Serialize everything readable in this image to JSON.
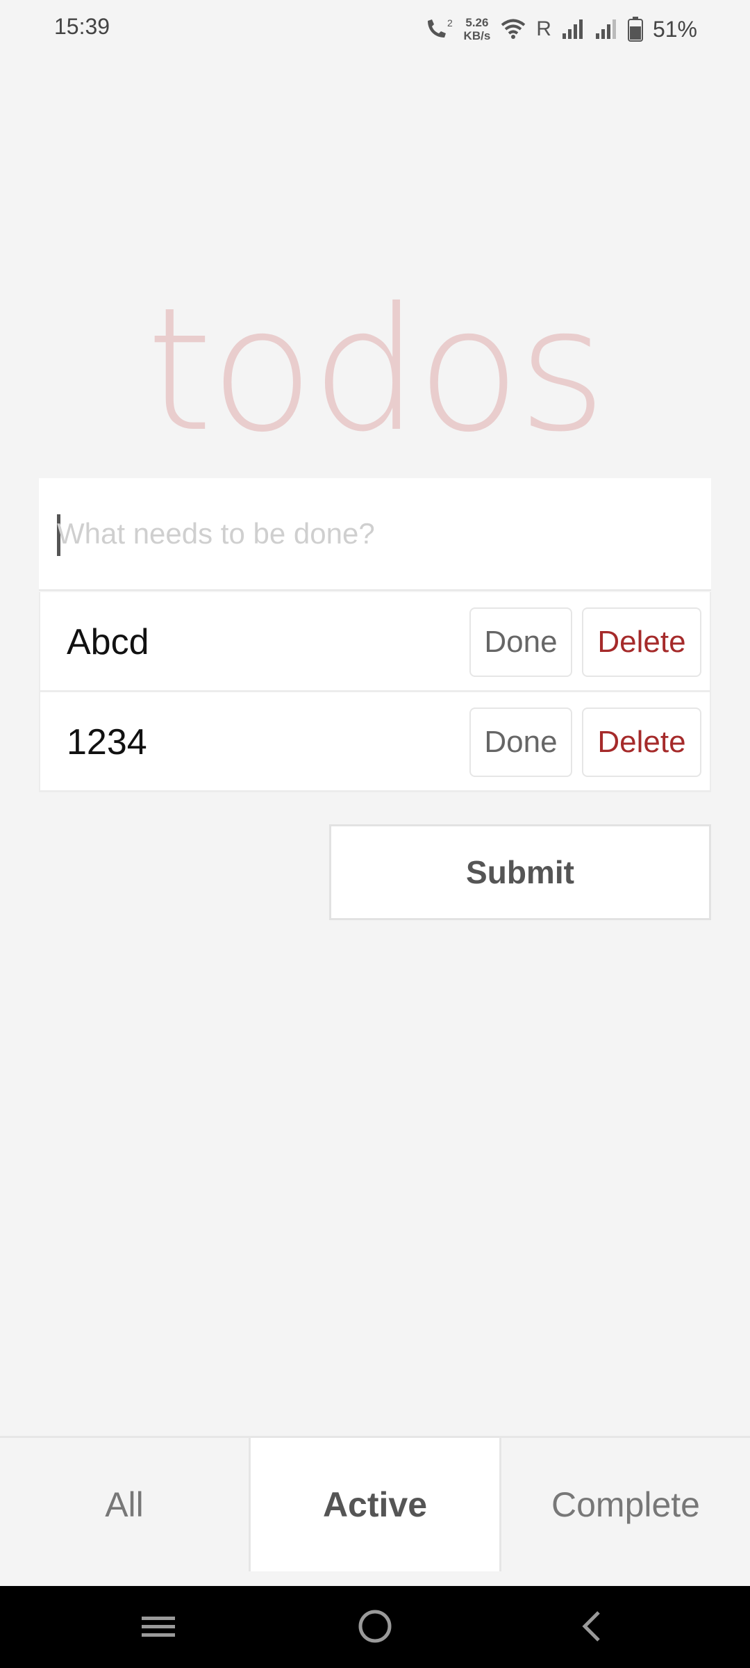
{
  "status_bar": {
    "time": "15:39",
    "net_speed_value": "5.26",
    "net_speed_unit": "KB/s",
    "roaming": "R",
    "battery_percent": "51%",
    "icons": [
      "call-icon",
      "wifi-icon",
      "signal-icon",
      "signal-icon",
      "battery-icon"
    ]
  },
  "app": {
    "title": "todos",
    "input_placeholder": "What needs to be done?",
    "input_value": ""
  },
  "todos": [
    {
      "label": "Abcd",
      "done_label": "Done",
      "delete_label": "Delete"
    },
    {
      "label": "1234",
      "done_label": "Done",
      "delete_label": "Delete"
    }
  ],
  "submit_label": "Submit",
  "filters": [
    {
      "label": "All",
      "active": false
    },
    {
      "label": "Active",
      "active": true
    },
    {
      "label": "Complete",
      "active": false
    }
  ],
  "nav_bar": {
    "icons": [
      "menu-icon",
      "home-icon",
      "back-icon"
    ]
  },
  "colors": {
    "title": "#e9cdcd",
    "delete": "#a52a2a",
    "background": "#f4f4f4"
  }
}
